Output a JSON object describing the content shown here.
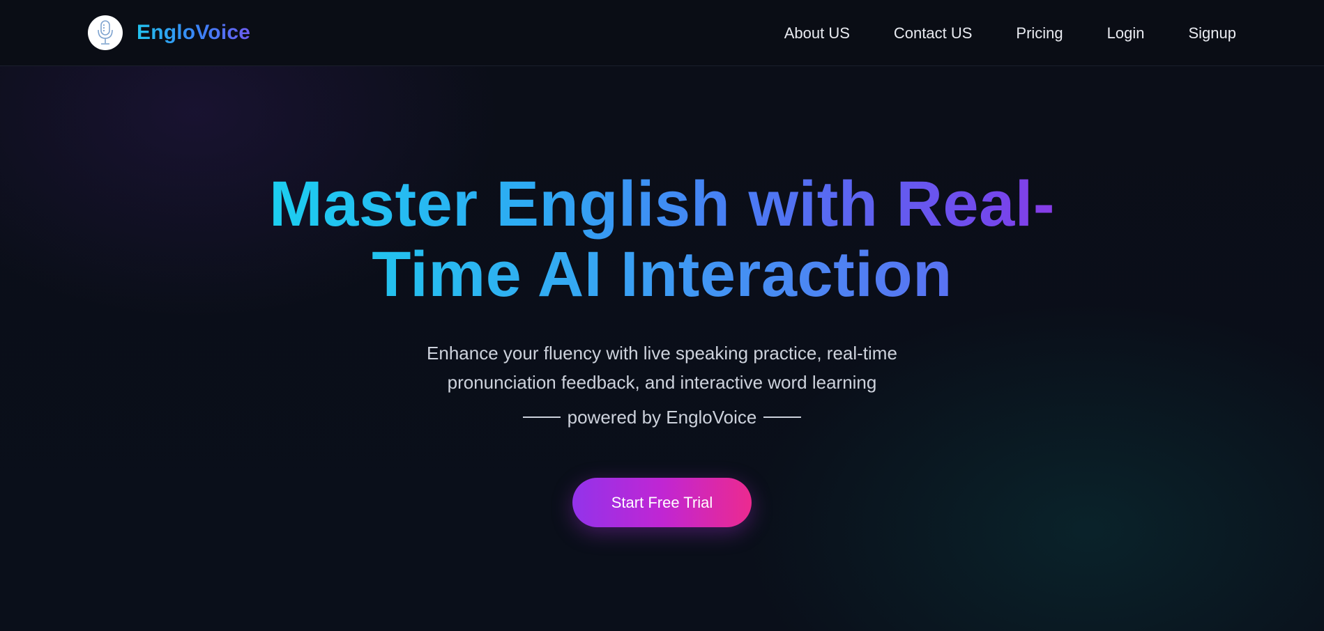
{
  "brand": {
    "name": "EngloVoice",
    "logo_icon": "microphone-icon"
  },
  "nav": {
    "items": [
      {
        "label": "About US"
      },
      {
        "label": "Contact US"
      },
      {
        "label": "Pricing"
      },
      {
        "label": "Login"
      },
      {
        "label": "Signup"
      }
    ]
  },
  "hero": {
    "title_line1": "Master English with Real-",
    "title_line2": "Time AI Interaction",
    "subtitle_line1": "Enhance your fluency with live speaking practice, real-time",
    "subtitle_line2": "pronunciation feedback, and interactive word learning",
    "powered_by": "powered by EngloVoice",
    "cta_label": "Start Free Trial"
  },
  "colors": {
    "background": "#0a0d16",
    "brand_gradient_start": "#22c3ee",
    "brand_gradient_end": "#6d5cf0",
    "cta_gradient_start": "#9333ea",
    "cta_gradient_end": "#ec2a8f"
  }
}
